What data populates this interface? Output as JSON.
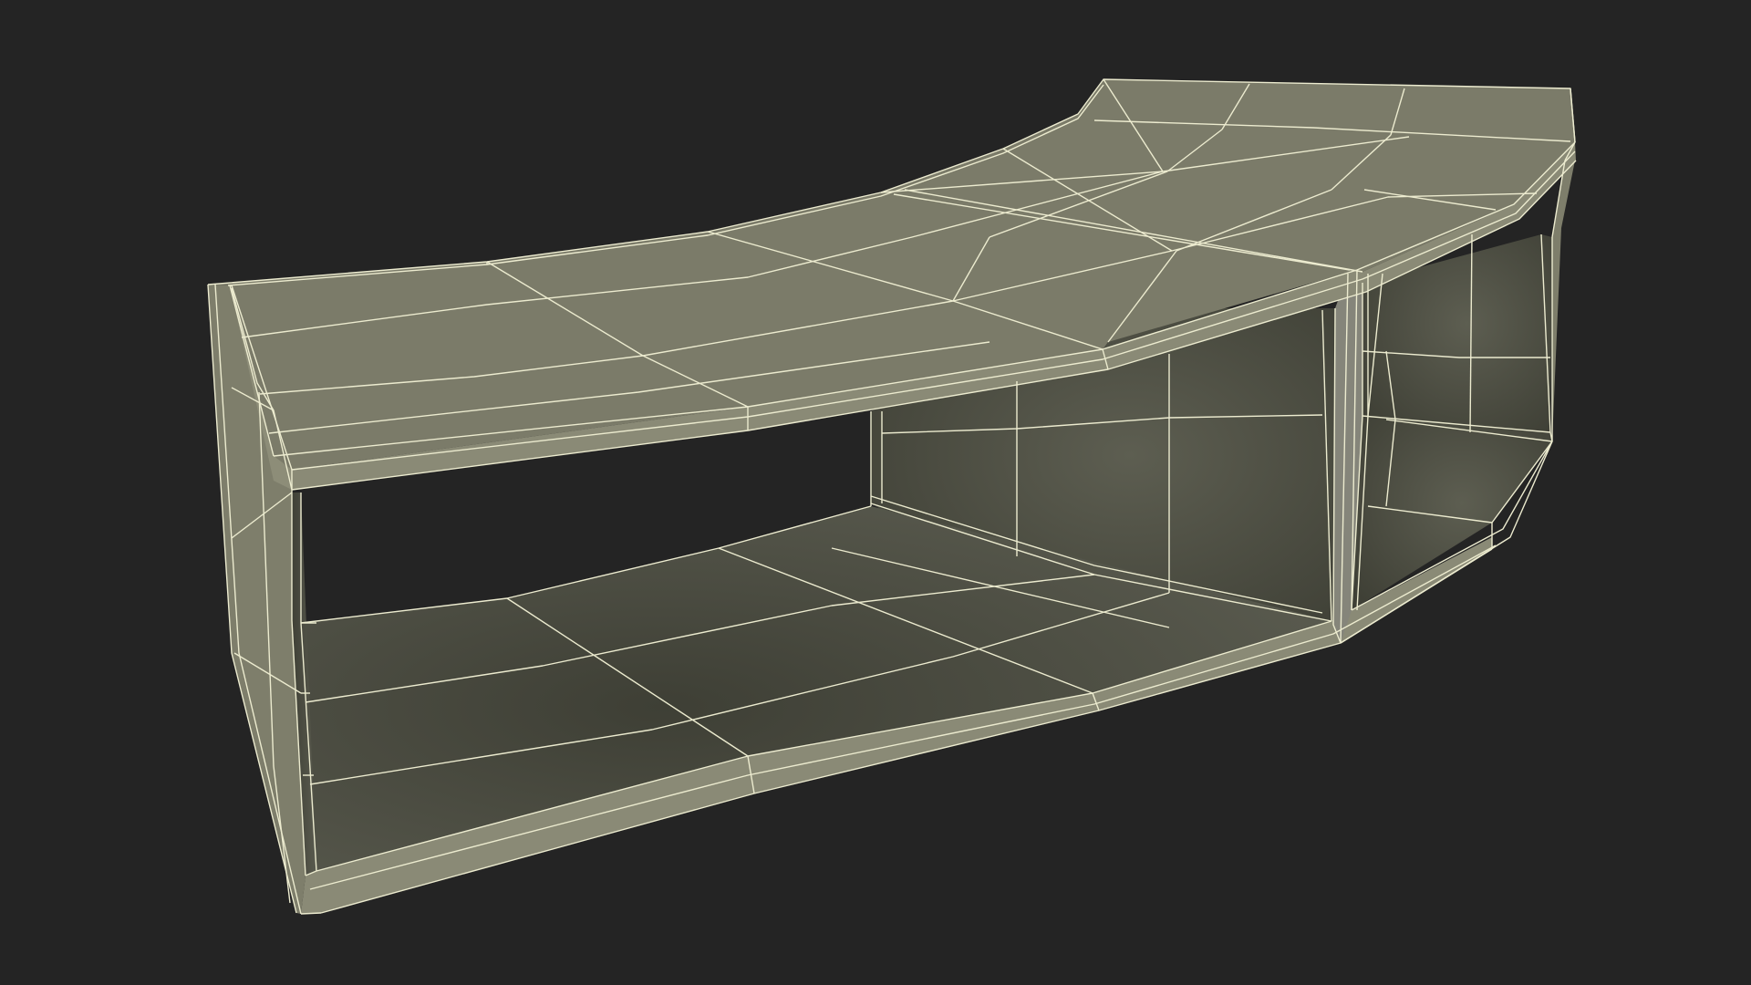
{
  "scene": {
    "subject": "curved-shelf-wireframe",
    "view": "perspective",
    "shading": "solid-with-wireframe"
  },
  "colors": {
    "background": "#242424",
    "surface_top": "#7a7a68",
    "surface_top_light": "#83836f",
    "surface_inner": "#54554a",
    "surface_inner_dark": "#3f4036",
    "edge_face": "#8a8a76",
    "wire": "#ecebcf"
  }
}
